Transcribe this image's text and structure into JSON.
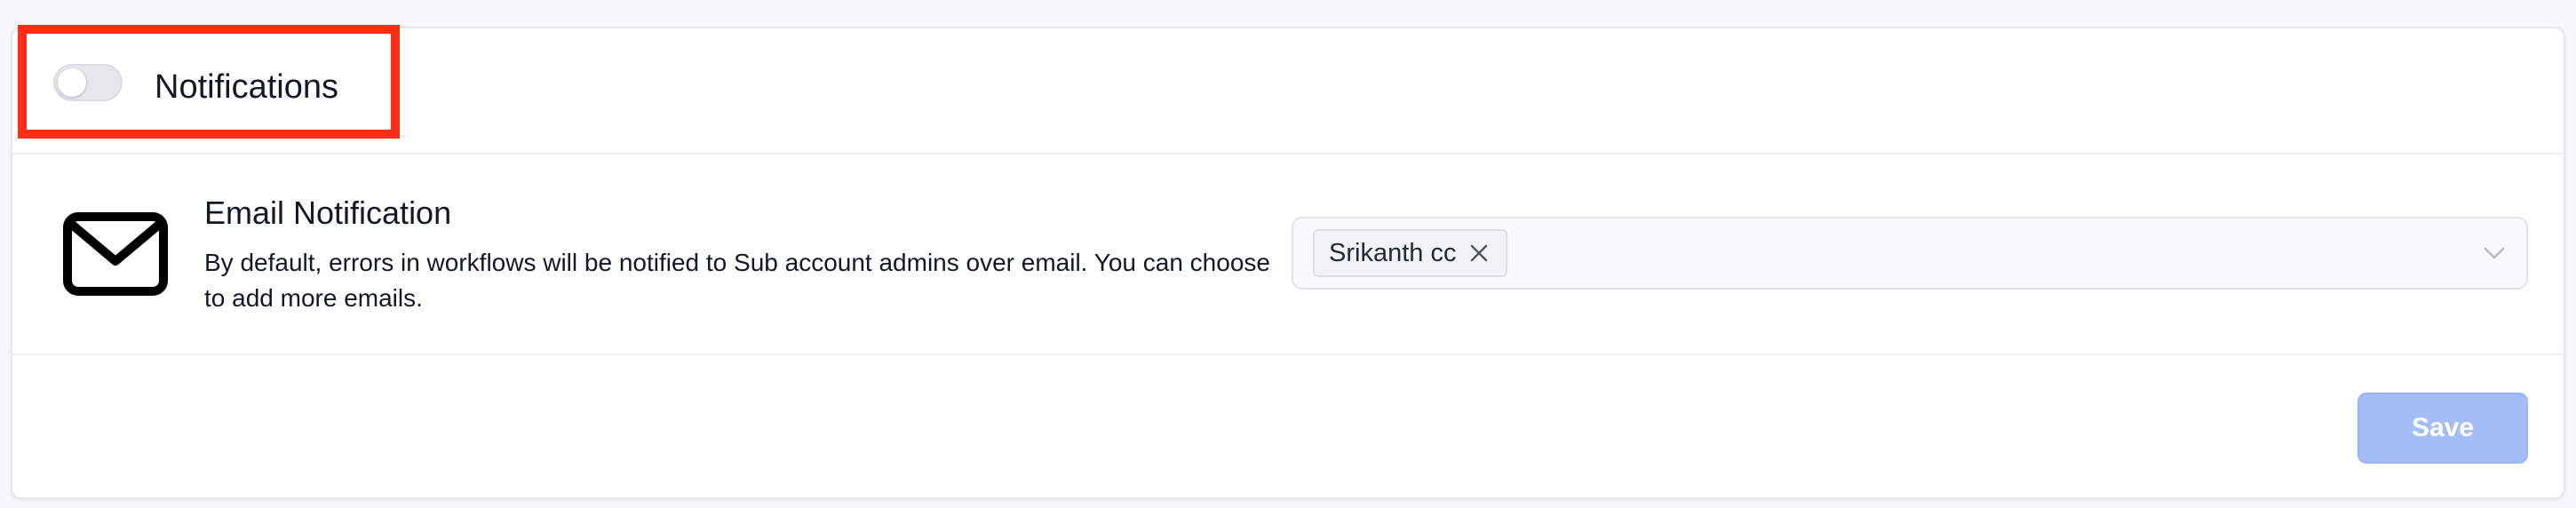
{
  "notifications": {
    "title": "Notifications",
    "toggle_enabled": false,
    "highlight_color": "#ff2d16"
  },
  "email_notification": {
    "title": "Email Notification",
    "description": "By default, errors in workflows will be notified to Sub account admins over email. You can choose to add more emails.",
    "icon": "mail-icon",
    "recipients": [
      {
        "label": "Srikanth cc"
      }
    ]
  },
  "footer": {
    "save_label": "Save",
    "save_color": "#a3bdf7"
  }
}
